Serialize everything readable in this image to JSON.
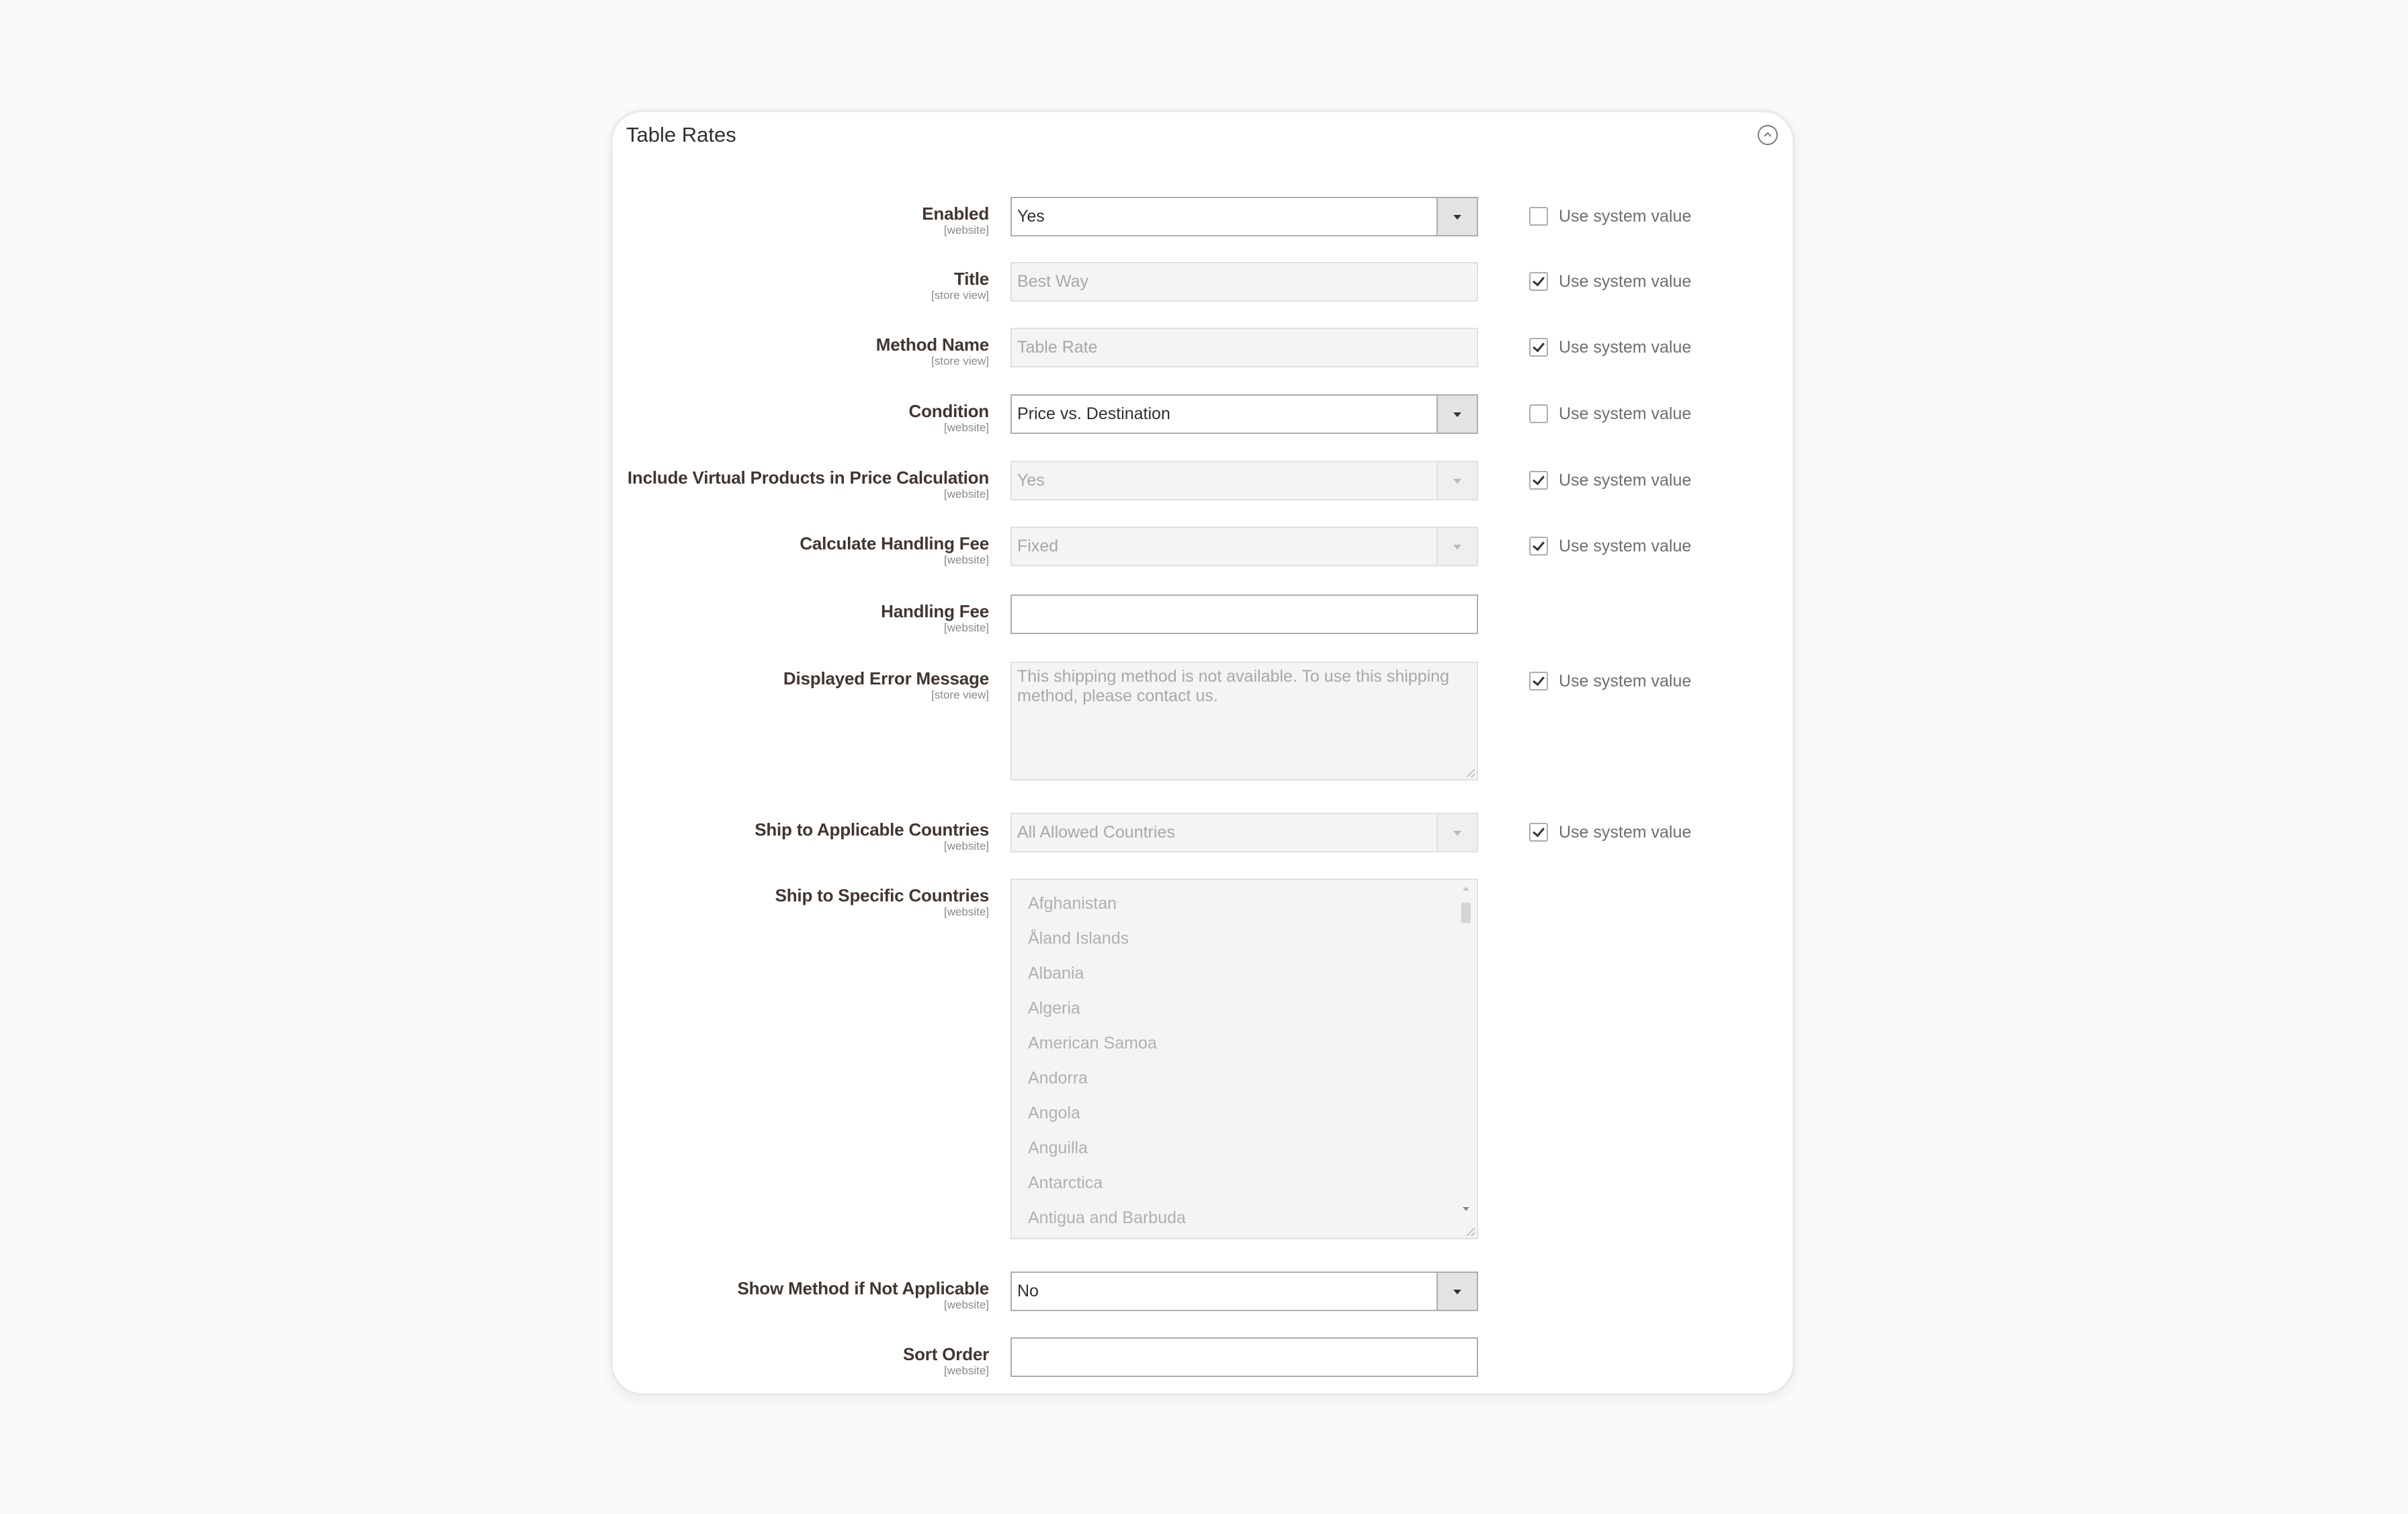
{
  "section": {
    "title": "Table Rates",
    "collapse_icon": "chevron-up-circle-icon"
  },
  "use_system_value_label": "Use system value",
  "fields": [
    {
      "id": "enabled",
      "label": "Enabled",
      "scope": "[website]",
      "type": "select",
      "value": "Yes",
      "disabled": false,
      "use_system_value": false
    },
    {
      "id": "title",
      "label": "Title",
      "scope": "[store view]",
      "type": "text",
      "value": "Best Way",
      "disabled": true,
      "use_system_value": true
    },
    {
      "id": "method-name",
      "label": "Method Name",
      "scope": "[store view]",
      "type": "text",
      "value": "Table Rate",
      "disabled": true,
      "use_system_value": true
    },
    {
      "id": "condition",
      "label": "Condition",
      "scope": "[website]",
      "type": "select",
      "value": "Price vs. Destination",
      "disabled": false,
      "use_system_value": false
    },
    {
      "id": "include-virtual",
      "label": "Include Virtual Products in Price Calculation",
      "scope": "[website]",
      "type": "select",
      "value": "Yes",
      "disabled": true,
      "use_system_value": true
    },
    {
      "id": "calc-handling-fee",
      "label": "Calculate Handling Fee",
      "scope": "[website]",
      "type": "select",
      "value": "Fixed",
      "disabled": true,
      "use_system_value": true
    },
    {
      "id": "handling-fee",
      "label": "Handling Fee",
      "scope": "[website]",
      "type": "text",
      "value": "",
      "disabled": false,
      "use_system_value": null
    },
    {
      "id": "error-message",
      "label": "Displayed Error Message",
      "scope": "[store view]",
      "type": "textarea",
      "value": "This shipping method is not available. To use this shipping method, please contact us.",
      "disabled": true,
      "use_system_value": true
    },
    {
      "id": "applicable-countries",
      "label": "Ship to Applicable Countries",
      "scope": "[website]",
      "type": "select",
      "value": "All Allowed Countries",
      "disabled": true,
      "use_system_value": true
    },
    {
      "id": "specific-countries",
      "label": "Ship to Specific Countries",
      "scope": "[website]",
      "type": "multiselect",
      "disabled": true,
      "use_system_value": null,
      "options": [
        "Afghanistan",
        "Åland Islands",
        "Albania",
        "Algeria",
        "American Samoa",
        "Andorra",
        "Angola",
        "Anguilla",
        "Antarctica",
        "Antigua and Barbuda"
      ]
    },
    {
      "id": "show-method",
      "label": "Show Method if Not Applicable",
      "scope": "[website]",
      "type": "select",
      "value": "No",
      "disabled": false,
      "use_system_value": null
    },
    {
      "id": "sort-order",
      "label": "Sort Order",
      "scope": "[website]",
      "type": "text",
      "value": "",
      "disabled": false,
      "use_system_value": null
    }
  ]
}
